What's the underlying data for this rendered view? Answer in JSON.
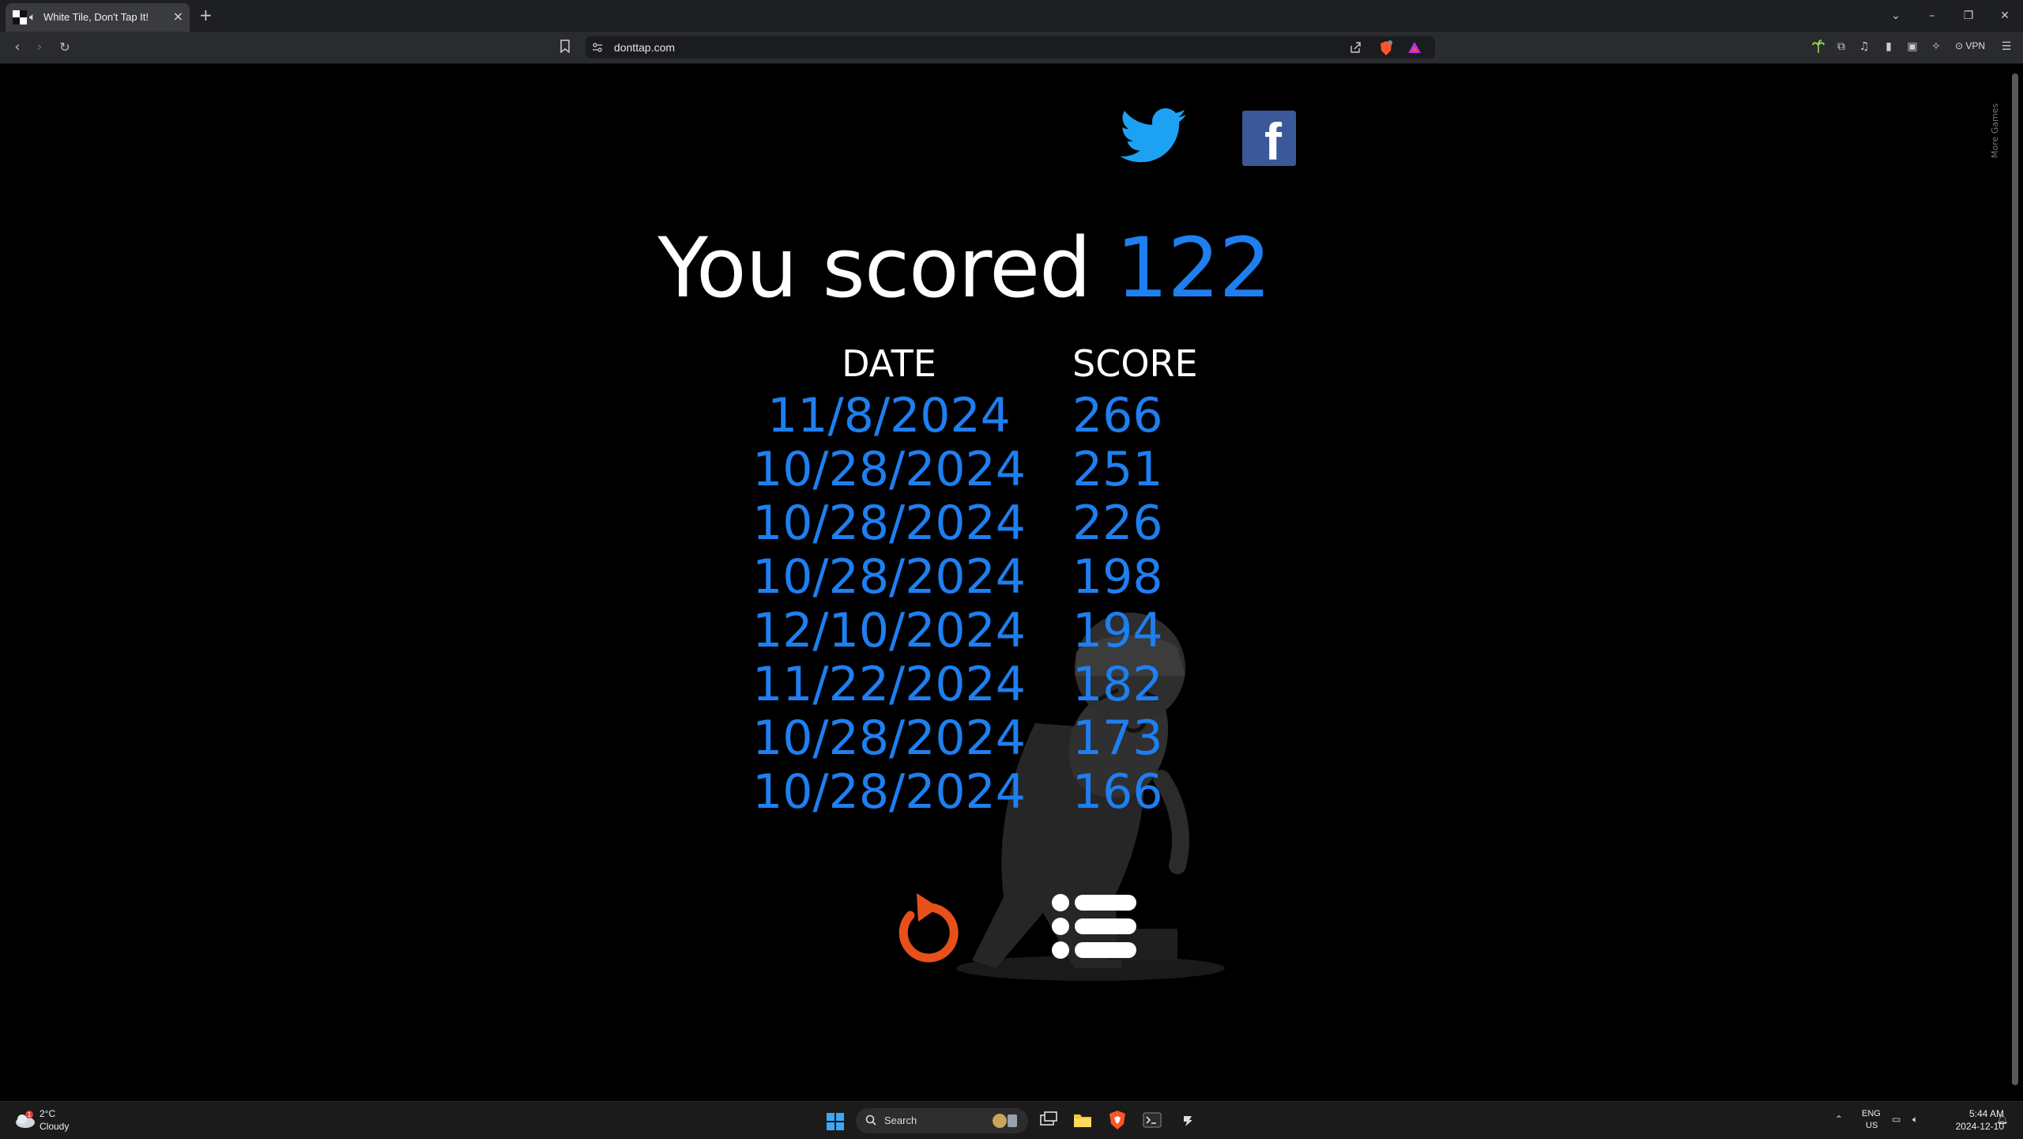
{
  "browser": {
    "tab_title": "White Tile, Don't Tap It!",
    "tab_audio_icon": "speaker-icon",
    "new_tab_label": "+",
    "url": "donttap.com",
    "vpn_label": "VPN",
    "window_controls": [
      "chevron-down-icon",
      "minimize-icon",
      "restore-icon",
      "close-icon"
    ]
  },
  "page": {
    "side_tab_label": "More Games",
    "score_prefix": "You scored",
    "score_value": "122",
    "table": {
      "date_header": "DATE",
      "score_header": "SCORE",
      "rows": [
        {
          "date": "11/8/2024",
          "score": "266"
        },
        {
          "date": "10/28/2024",
          "score": "251"
        },
        {
          "date": "10/28/2024",
          "score": "226"
        },
        {
          "date": "10/28/2024",
          "score": "198"
        },
        {
          "date": "12/10/2024",
          "score": "194"
        },
        {
          "date": "11/22/2024",
          "score": "182"
        },
        {
          "date": "10/28/2024",
          "score": "173"
        },
        {
          "date": "10/28/2024",
          "score": "166"
        }
      ]
    },
    "colors": {
      "accent_blue": "#1e7ff0",
      "restart_orange": "#e8501a",
      "twitter_blue": "#1da1f2",
      "facebook_blue": "#3b5998"
    }
  },
  "taskbar": {
    "weather_temp": "2°C",
    "weather_desc": "Cloudy",
    "weather_badge": "1",
    "search_label": "Search",
    "lang_line1": "ENG",
    "lang_line2": "US",
    "time": "5:44 AM",
    "date": "2024-12-10"
  }
}
